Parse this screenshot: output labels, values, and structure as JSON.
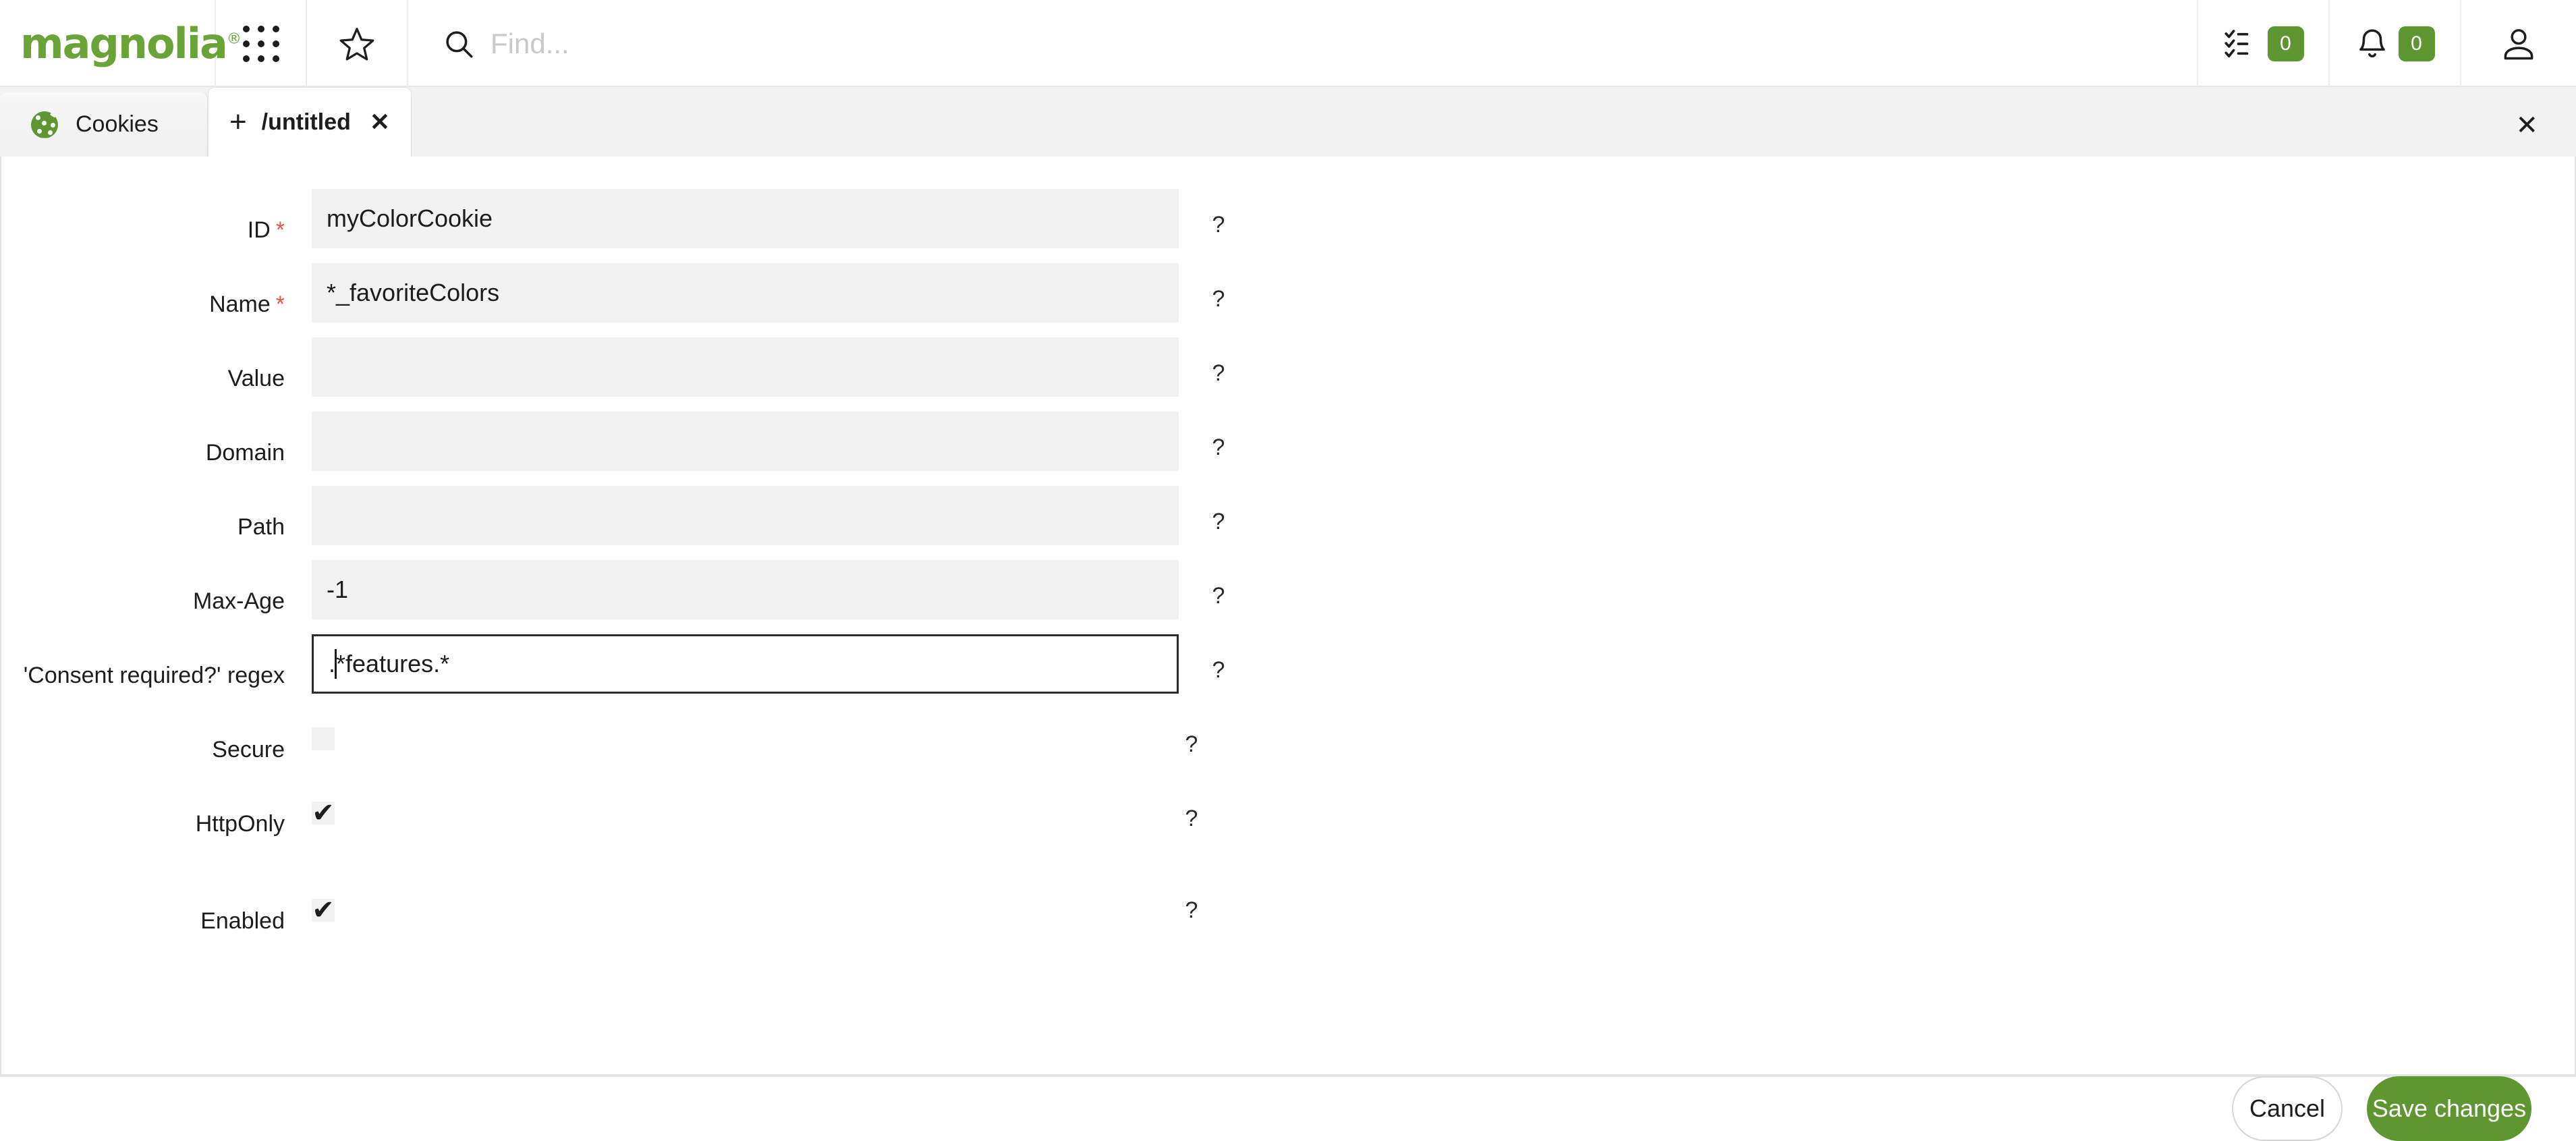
{
  "header": {
    "logo_text": "magnolia",
    "logo_registered": "®",
    "apps_icon": "apps-grid-icon",
    "favorites_icon": "star-icon",
    "search": {
      "icon": "search-icon",
      "placeholder": "Find..."
    },
    "tasks": {
      "icon": "tasks-checklist-icon",
      "count": "0"
    },
    "notifications": {
      "icon": "bell-icon",
      "count": "0"
    },
    "user_icon": "user-avatar-icon",
    "accent_color": "#5E9732"
  },
  "tabs": {
    "items": [
      {
        "label": "Cookies",
        "icon": "cookie-icon",
        "active": false
      },
      {
        "label": "/untitled",
        "icon": "plus-icon",
        "active": true,
        "close_glyph": "✕"
      }
    ],
    "close_all_glyph": "✕"
  },
  "form": {
    "help_glyph": "?",
    "required_glyph": "*",
    "fields": [
      {
        "label": "ID",
        "type": "text",
        "value": "myColorCookie",
        "required": true,
        "focused": false
      },
      {
        "label": "Name",
        "type": "text",
        "value": "*_favoriteColors",
        "required": true,
        "focused": false
      },
      {
        "label": "Value",
        "type": "text",
        "value": "",
        "required": false,
        "focused": false
      },
      {
        "label": "Domain",
        "type": "text",
        "value": "",
        "required": false,
        "focused": false
      },
      {
        "label": "Path",
        "type": "text",
        "value": "",
        "required": false,
        "focused": false
      },
      {
        "label": "Max-Age",
        "type": "text",
        "value": "-1",
        "required": false,
        "focused": false
      },
      {
        "label": "'Consent required?' regex",
        "type": "text",
        "value": ".*features.*",
        "required": false,
        "focused": true,
        "value_before_caret": ".",
        "value_after_caret": "*features.*"
      },
      {
        "label": "Secure",
        "type": "checkbox",
        "checked": false
      },
      {
        "label": "HttpOnly",
        "type": "checkbox",
        "checked": true,
        "check_glyph": "✔"
      },
      {
        "label": "Enabled",
        "type": "checkbox",
        "checked": true,
        "check_glyph": "✔"
      }
    ]
  },
  "footer": {
    "cancel_label": "Cancel",
    "save_label": "Save changes"
  }
}
